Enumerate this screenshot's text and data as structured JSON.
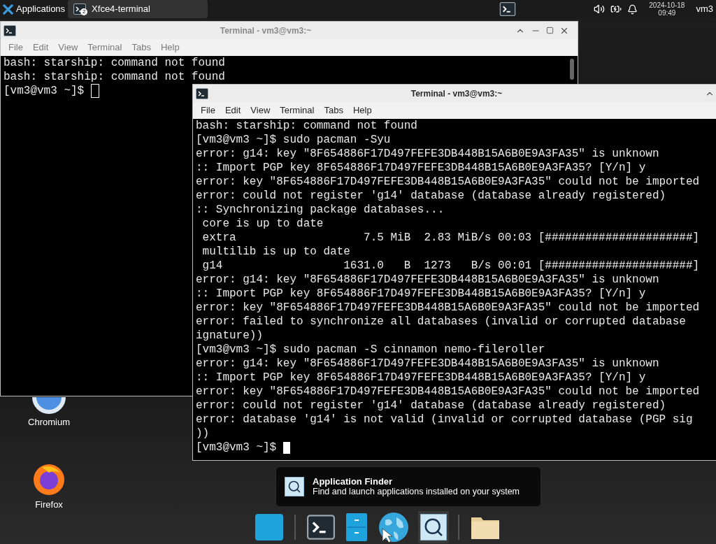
{
  "top_panel": {
    "applications_menu": "Applications",
    "tasks": [
      {
        "label": "Xfce4-terminal",
        "count": "2",
        "selected": true
      }
    ],
    "clock": {
      "date": "2024-10-18",
      "time": "09:49"
    },
    "user": "vm3"
  },
  "desktop_icons": [
    {
      "kind": "chromium",
      "label": "Chromium"
    },
    {
      "kind": "firefox",
      "label": "Firefox"
    }
  ],
  "windows": [
    {
      "title": "Terminal - vm3@vm3:~",
      "focused": false,
      "menu": [
        "File",
        "Edit",
        "View",
        "Terminal",
        "Tabs",
        "Help"
      ],
      "lines": [
        "bash: starship: command not found",
        "bash: starship: command not found",
        "[vm3@vm3 ~]$ "
      ]
    },
    {
      "title": "Terminal - vm3@vm3:~",
      "focused": true,
      "menu": [
        "File",
        "Edit",
        "View",
        "Terminal",
        "Tabs",
        "Help"
      ],
      "lines": [
        "bash: starship: command not found",
        "[vm3@vm3 ~]$ sudo pacman -Syu",
        "error: g14: key \"8F654886F17D497FEFE3DB448B15A6B0E9A3FA35\" is unknown",
        ":: Import PGP key 8F654886F17D497FEFE3DB448B15A6B0E9A3FA35? [Y/n] y",
        "error: key \"8F654886F17D497FEFE3DB448B15A6B0E9A3FA35\" could not be imported",
        "error: could not register 'g14' database (database already registered)",
        ":: Synchronizing package databases...",
        " core is up to date",
        " extra                   7.5 MiB  2.83 MiB/s 00:03 [######################]",
        " multilib is up to date",
        " g14                  1631.0   B  1273   B/s 00:01 [######################]",
        "error: g14: key \"8F654886F17D497FEFE3DB448B15A6B0E9A3FA35\" is unknown",
        ":: Import PGP key 8F654886F17D497FEFE3DB448B15A6B0E9A3FA35? [Y/n] y",
        "error: key \"8F654886F17D497FEFE3DB448B15A6B0E9A3FA35\" could not be imported",
        "error: failed to synchronize all databases (invalid or corrupted database",
        "ignature))",
        "[vm3@vm3 ~]$ sudo pacman -S cinnamon nemo-fileroller",
        "error: g14: key \"8F654886F17D497FEFE3DB448B15A6B0E9A3FA35\" is unknown",
        ":: Import PGP key 8F654886F17D497FEFE3DB448B15A6B0E9A3FA35? [Y/n] y",
        "error: key \"8F654886F17D497FEFE3DB448B15A6B0E9A3FA35\" could not be imported",
        "error: could not register 'g14' database (database already registered)",
        "error: database 'g14' is not valid (invalid or corrupted database (PGP sig",
        "))",
        "[vm3@vm3 ~]$ "
      ]
    }
  ],
  "tooltip": {
    "title": "Application Finder",
    "description": "Find and launch applications installed on your system"
  },
  "dock": {
    "items": [
      {
        "kind": "show-desktop",
        "selected": false
      },
      {
        "kind": "separator",
        "selected": false
      },
      {
        "kind": "terminal",
        "selected": false
      },
      {
        "kind": "file-manager",
        "selected": false
      },
      {
        "kind": "web-browser",
        "selected": false
      },
      {
        "kind": "app-finder",
        "selected": true
      },
      {
        "kind": "separator",
        "selected": false
      },
      {
        "kind": "folder",
        "selected": false
      }
    ]
  }
}
